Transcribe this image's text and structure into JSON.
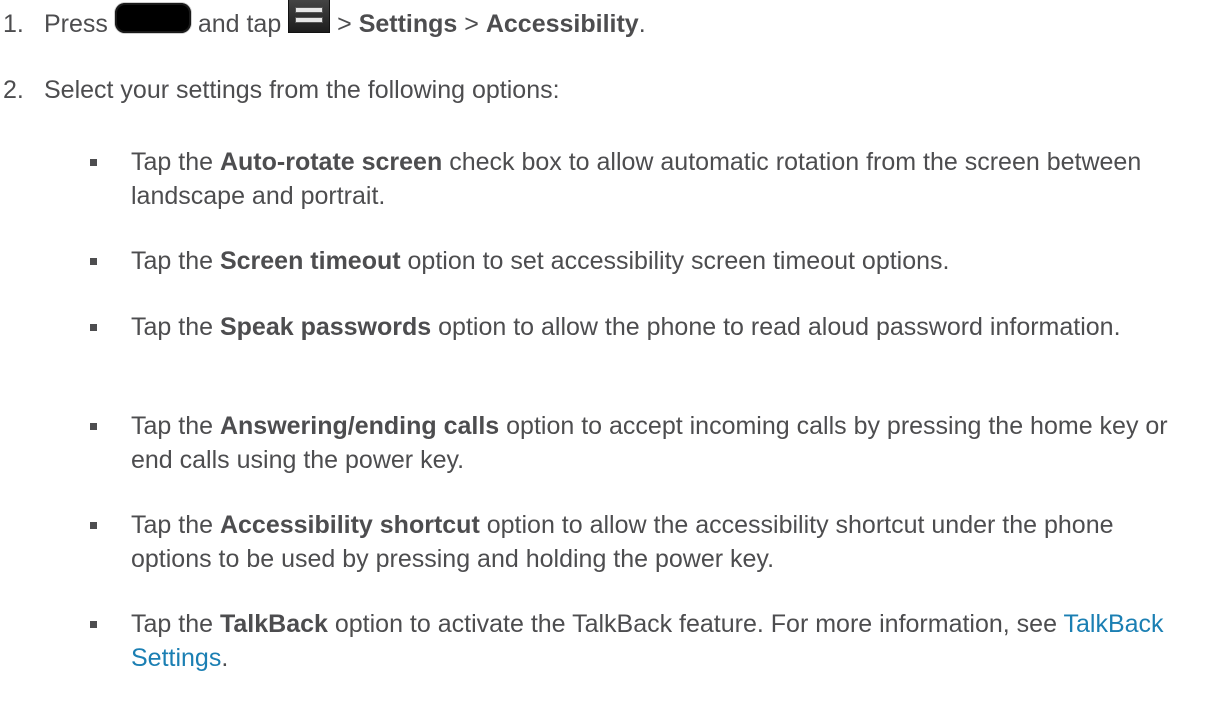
{
  "steps": [
    {
      "number": "1.",
      "press": "Press",
      "and_tap": "and tap",
      "sep1": ">",
      "settings": "Settings",
      "sep2": ">",
      "accessibility": "Accessibility",
      "end": "."
    },
    {
      "number": "2.",
      "text": "Select your settings from the following options:"
    }
  ],
  "icons": {
    "home_key": "home-key-icon",
    "menu_key": "menu-key-icon"
  },
  "options": [
    {
      "pre": "Tap the",
      "bold": "Auto-rotate screen",
      "post": "check box to allow automatic rotation from the screen between landscape and portrait."
    },
    {
      "pre": "Tap the",
      "bold": "Screen timeout",
      "post": "option to set accessibility screen timeout options."
    },
    {
      "pre": "Tap the",
      "bold": "Speak passwords",
      "post": "option to allow the phone to read aloud password information."
    },
    {
      "pre": "Tap the",
      "bold": "Answering/ending calls",
      "post": "option to accept incoming calls by pressing the home key or end calls using the power key."
    },
    {
      "pre": "Tap the",
      "bold": "Accessibility shortcut",
      "post": "option to allow the accessibility shortcut under the phone options to be used by pressing and holding the power key."
    },
    {
      "pre": "Tap the",
      "bold": "TalkBack",
      "post": "option to activate the TalkBack feature. For more information, see",
      "link": "TalkBack Settings",
      "end": "."
    }
  ],
  "colors": {
    "text": "#4d4d4f",
    "link": "#1b7fb3"
  }
}
